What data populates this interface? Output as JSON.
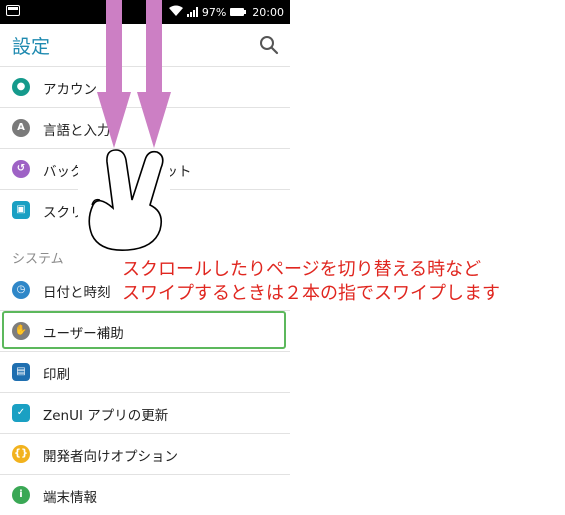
{
  "status_bar": {
    "battery": "97%",
    "time": "20:00"
  },
  "app_bar": {
    "title": "設定"
  },
  "settings_top": [
    {
      "label": "アカウン",
      "icon": "account-icon",
      "color": "#159a8c"
    },
    {
      "label": "言語と入力",
      "icon": "language-icon",
      "color": "#7a7a7a"
    },
    {
      "label": "バックアップとリセット",
      "icon": "backup-icon",
      "color": "#9e62c5"
    },
    {
      "label": "スクリ",
      "icon": "screenshot-icon",
      "color": "#1aa0c3"
    }
  ],
  "section": {
    "title": "システム"
  },
  "settings_system": [
    {
      "label": "日付と時刻",
      "icon": "clock-icon",
      "color": "#2f87c8"
    },
    {
      "label": "ユーザー補助",
      "icon": "hand-icon",
      "color": "#7d7d7d"
    },
    {
      "label": "印刷",
      "icon": "print-icon",
      "color": "#1f6fb0"
    },
    {
      "label": "ZenUI アプリの更新",
      "icon": "update-icon",
      "color": "#1aa0c3"
    },
    {
      "label": "開発者向けオプション",
      "icon": "developer-icon",
      "color": "#f2b21d"
    },
    {
      "label": "端末情報",
      "icon": "info-icon",
      "color": "#3aa855"
    }
  ],
  "annotation": {
    "line1": "スクロールしたりページを切り替える時など",
    "line2": "スワイプするときは２本の指でスワイプします",
    "color": "#e0261f"
  },
  "highlight_color": "#5cb85c",
  "arrow_color": "#cc7fc4"
}
